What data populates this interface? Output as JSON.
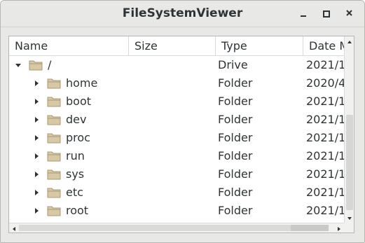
{
  "window": {
    "title": "FileSystemViewer"
  },
  "columns": [
    "Name",
    "Size",
    "Type",
    "Date M"
  ],
  "rows": [
    {
      "name": "/",
      "size": "",
      "type": "Drive",
      "date": "2021/1",
      "level": 0,
      "expanded": true
    },
    {
      "name": "home",
      "size": "",
      "type": "Folder",
      "date": "2020/4",
      "level": 1,
      "expanded": false
    },
    {
      "name": "boot",
      "size": "",
      "type": "Folder",
      "date": "2021/1",
      "level": 1,
      "expanded": false
    },
    {
      "name": "dev",
      "size": "",
      "type": "Folder",
      "date": "2021/1",
      "level": 1,
      "expanded": false
    },
    {
      "name": "proc",
      "size": "",
      "type": "Folder",
      "date": "2021/1",
      "level": 1,
      "expanded": false
    },
    {
      "name": "run",
      "size": "",
      "type": "Folder",
      "date": "2021/1",
      "level": 1,
      "expanded": false
    },
    {
      "name": "sys",
      "size": "",
      "type": "Folder",
      "date": "2021/1",
      "level": 1,
      "expanded": false
    },
    {
      "name": "etc",
      "size": "",
      "type": "Folder",
      "date": "2021/1",
      "level": 1,
      "expanded": false
    },
    {
      "name": "root",
      "size": "",
      "type": "Folder",
      "date": "2021/1",
      "level": 1,
      "expanded": false
    }
  ],
  "icons": {
    "folder": "folder-icon",
    "expanded": "expanded-arrow-icon",
    "collapsed": "collapsed-arrow-icon"
  },
  "colors": {
    "folder_fill": "#d9c8a4",
    "folder_stroke": "#a89874",
    "text": "#2e3436"
  }
}
